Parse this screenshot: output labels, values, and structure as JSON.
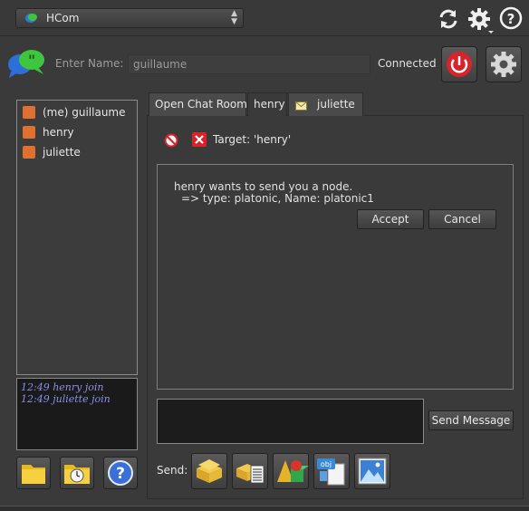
{
  "topbar": {
    "panel_name": "HCom",
    "refresh_icon": "refresh-icon",
    "gear_icon": "gear-menu-icon",
    "help_icon": "help-icon"
  },
  "header": {
    "name_label": "Enter Name:",
    "name_value": "guillaume",
    "status": "Connected"
  },
  "users": [
    {
      "name": "(me) guillaume"
    },
    {
      "name": "henry"
    },
    {
      "name": "juliette"
    }
  ],
  "log": [
    "12:49 henry join",
    "12:49 juliette join"
  ],
  "tabs": [
    {
      "label": "Open Chat Room"
    },
    {
      "label": "henry"
    },
    {
      "label": "juliette"
    }
  ],
  "chat": {
    "target": "Target: 'henry'",
    "message_line1": "henry wants to send you a node.",
    "message_line2": "=> type: platonic, Name: platonic1",
    "accept_label": "Accept",
    "cancel_label": "Cancel",
    "send_message_label": "Send Message",
    "send_label": "Send:"
  },
  "colors": {
    "background": "#3a3a3a",
    "accent_red": "#d9232a",
    "log_text": "#8a8ee8",
    "user_icon": "#e07030"
  }
}
